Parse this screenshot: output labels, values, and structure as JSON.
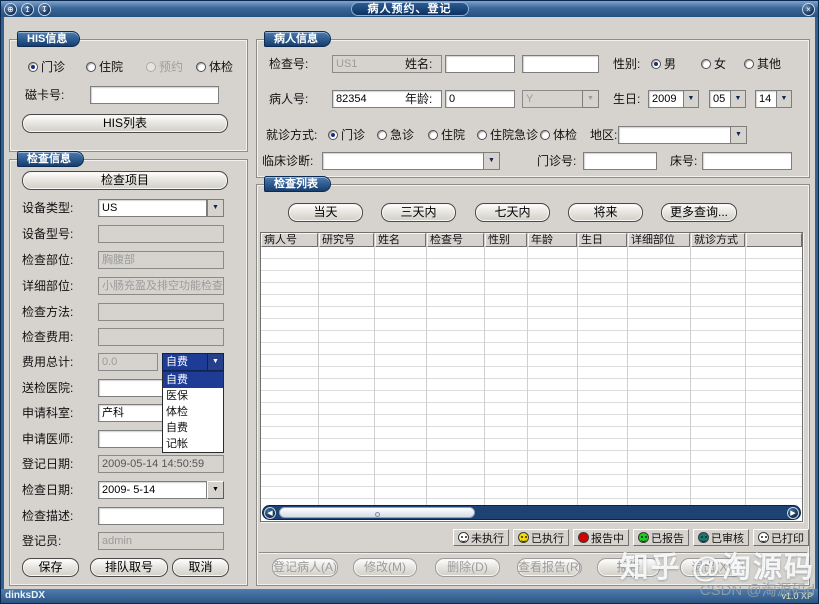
{
  "window": {
    "title": "病人预约、登记",
    "statusbar_left": "dinksDX",
    "statusbar_right": "v1.0 XP"
  },
  "icons": {
    "titlebar": [
      "⊕",
      "↥",
      "↧"
    ],
    "close": "×",
    "dropdown": "▼",
    "scroll_left": "◀",
    "scroll_right": "▶"
  },
  "his": {
    "tab": "HIS信息",
    "visit_types": [
      {
        "label": "门诊",
        "selected": true
      },
      {
        "label": "住院",
        "selected": false
      },
      {
        "label": "预约",
        "selected": false,
        "disabled": true
      },
      {
        "label": "体检",
        "selected": false
      }
    ],
    "card_no_label": "磁卡号:",
    "card_no_value": "",
    "his_list_button": "HIS列表"
  },
  "exam": {
    "tab": "检查信息",
    "exam_item_button": "检查项目",
    "rows": {
      "device_type": {
        "label": "设备类型:",
        "value": "US"
      },
      "device_model": {
        "label": "设备型号:",
        "value": ""
      },
      "body_part": {
        "label": "检查部位:",
        "value": "胸腹部"
      },
      "detail_part": {
        "label": "详细部位:",
        "value": "小肠充盈及排空功能检查"
      },
      "method": {
        "label": "检查方法:",
        "value": ""
      },
      "fee": {
        "label": "检查费用:",
        "value": ""
      },
      "fee_total": {
        "label": "费用总计:",
        "value": "0.0",
        "pay_type": "自费"
      },
      "hospital": {
        "label": "送检医院:",
        "value": ""
      },
      "department": {
        "label": "申请科室:",
        "value": "产科"
      },
      "physician": {
        "label": "申请医师:",
        "value": ""
      },
      "reg_date": {
        "label": "登记日期:",
        "value": "2009-05-14 14:50:59"
      },
      "exam_date": {
        "label": "检查日期:",
        "value": "2009- 5-14"
      },
      "description": {
        "label": "检查描述:",
        "value": ""
      },
      "registrar": {
        "label": "登记员:",
        "value": "admin"
      }
    },
    "pay_type_options": [
      "自费",
      "医保",
      "体检",
      "自费",
      "记帐"
    ],
    "buttons": {
      "save": "保存",
      "queue": "排队取号",
      "cancel": "取消"
    }
  },
  "patient": {
    "tab": "病人信息",
    "exam_no": {
      "label": "检查号:",
      "value": "US1"
    },
    "name": {
      "label": "姓名:",
      "value": "",
      "value2": ""
    },
    "gender": {
      "label": "性别:",
      "options": [
        {
          "label": "男",
          "selected": true
        },
        {
          "label": "女",
          "selected": false
        },
        {
          "label": "其他",
          "selected": false
        }
      ]
    },
    "patient_no": {
      "label": "病人号:",
      "value": "82354"
    },
    "age": {
      "label": "年龄:",
      "value": "0",
      "unit": "Y"
    },
    "birthday": {
      "label": "生日:",
      "year": "2009",
      "month": "05",
      "day": "14"
    },
    "visit_type": {
      "label": "就诊方式:",
      "options": [
        {
          "label": "门诊",
          "selected": true
        },
        {
          "label": "急诊",
          "selected": false
        },
        {
          "label": "住院",
          "selected": false
        },
        {
          "label": "住院急诊",
          "selected": false
        },
        {
          "label": "体检",
          "selected": false
        }
      ]
    },
    "region": {
      "label": "地区:",
      "value": ""
    },
    "diagnosis": {
      "label": "临床诊断:",
      "value": ""
    },
    "outpatient_no": {
      "label": "门诊号:",
      "value": ""
    },
    "bed_no": {
      "label": "床号:",
      "value": ""
    }
  },
  "exam_list": {
    "tab": "检查列表",
    "filters": [
      "当天",
      "三天内",
      "七天内",
      "将来",
      "更多查询..."
    ],
    "columns": [
      "病人号",
      "研究号",
      "姓名",
      "检查号",
      "性别",
      "年龄",
      "生日",
      "详细部位",
      "就诊方式"
    ],
    "rows": [],
    "legend": [
      {
        "label": "未执行",
        "color": "#FFFFFF"
      },
      {
        "label": "已执行",
        "color": "#F5DC00"
      },
      {
        "label": "报告中",
        "color": "#D40000"
      },
      {
        "label": "已报告",
        "color": "#1FCC1F"
      },
      {
        "label": "已审核",
        "color": "#147878"
      },
      {
        "label": "已打印",
        "color": "#FFFFFF"
      }
    ],
    "actions": [
      "登记病人(A)",
      "修改(M)",
      "删除(D)",
      "查看报告(R)",
      "报告",
      "退出(X)"
    ]
  },
  "watermark": {
    "line1": "知乎 @淘源码",
    "line2": "CSDN @淘源码d"
  }
}
